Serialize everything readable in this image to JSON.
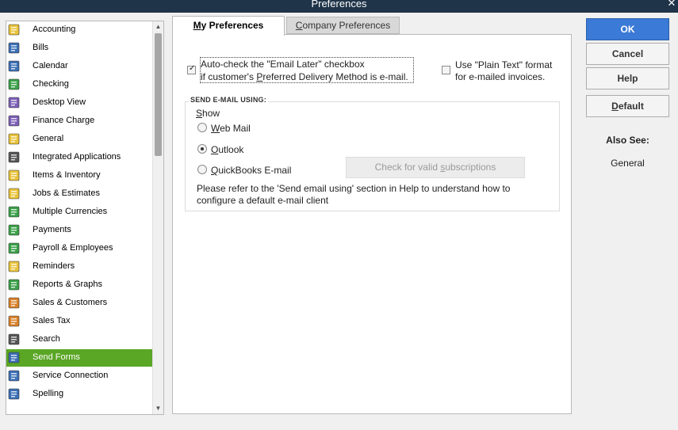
{
  "window": {
    "title": "Preferences"
  },
  "sidebar": {
    "items": [
      {
        "label": "Accounting",
        "icon": "accounting-icon",
        "color": "#e8c23a"
      },
      {
        "label": "Bills",
        "icon": "bills-icon",
        "color": "#3c6fb5"
      },
      {
        "label": "Calendar",
        "icon": "calendar-icon",
        "color": "#3c6fb5"
      },
      {
        "label": "Checking",
        "icon": "checking-icon",
        "color": "#3aa048"
      },
      {
        "label": "Desktop View",
        "icon": "desktop-view-icon",
        "color": "#7c5fb5"
      },
      {
        "label": "Finance Charge",
        "icon": "finance-charge-icon",
        "color": "#7c5fb5"
      },
      {
        "label": "General",
        "icon": "general-icon",
        "color": "#e8c23a"
      },
      {
        "label": "Integrated Applications",
        "icon": "integrated-applications-icon",
        "color": "#555555"
      },
      {
        "label": "Items & Inventory",
        "icon": "items-inventory-icon",
        "color": "#e8c23a"
      },
      {
        "label": "Jobs & Estimates",
        "icon": "jobs-estimates-icon",
        "color": "#e8c23a"
      },
      {
        "label": "Multiple Currencies",
        "icon": "multiple-currencies-icon",
        "color": "#3aa048"
      },
      {
        "label": "Payments",
        "icon": "payments-icon",
        "color": "#3aa048"
      },
      {
        "label": "Payroll & Employees",
        "icon": "payroll-employees-icon",
        "color": "#3aa048"
      },
      {
        "label": "Reminders",
        "icon": "reminders-icon",
        "color": "#e8c23a"
      },
      {
        "label": "Reports & Graphs",
        "icon": "reports-graphs-icon",
        "color": "#3aa048"
      },
      {
        "label": "Sales & Customers",
        "icon": "sales-customers-icon",
        "color": "#d9822b"
      },
      {
        "label": "Sales Tax",
        "icon": "sales-tax-icon",
        "color": "#d9822b"
      },
      {
        "label": "Search",
        "icon": "search-icon",
        "color": "#555555"
      },
      {
        "label": "Send Forms",
        "icon": "send-forms-icon",
        "color": "#3c6fb5",
        "selected": true
      },
      {
        "label": "Service Connection",
        "icon": "service-connection-icon",
        "color": "#3c6fb5"
      },
      {
        "label": "Spelling",
        "icon": "spelling-icon",
        "color": "#3c6fb5"
      }
    ],
    "selected_color": "#5aa625"
  },
  "tabs": {
    "my": {
      "label_ul": "M",
      "label_rest": "y Preferences"
    },
    "company": {
      "label_ul": "C",
      "label_rest": "ompany Preferences"
    }
  },
  "options": {
    "auto_check": {
      "line1": "Auto-check the \"Email Later\" checkbox",
      "line2_pre": "if customer's ",
      "line2_ul": "P",
      "line2_post": "referred Delivery Method is e-mail.",
      "checked": true
    },
    "plain_text": {
      "line1": "Use \"Plain Text\" format",
      "line2": "for e-mailed invoices.",
      "checked": false
    }
  },
  "send_email": {
    "legend": "SEND E-MAIL USING:",
    "show_ul": "S",
    "show_rest": "how",
    "radios": [
      {
        "ul": "W",
        "rest": "eb Mail",
        "selected": false
      },
      {
        "ul": "O",
        "rest": "utlook",
        "selected": true
      },
      {
        "ul": "Q",
        "rest": "uickBooks E-mail",
        "selected": false
      }
    ],
    "check_button": {
      "pre": "Check for valid ",
      "ul": "s",
      "post": "ubscriptions"
    },
    "note_line1": "Please refer to the 'Send email using' section in Help to understand how to",
    "note_line2": "configure a default e-mail client"
  },
  "buttons": {
    "ok": "OK",
    "cancel": "Cancel",
    "help": "Help",
    "default_ul": "D",
    "default_rest": "efault"
  },
  "also_see": {
    "title": "Also See:",
    "link": "General"
  },
  "colors": {
    "accent": "#3b7ad6",
    "titlebar": "#1f3449"
  }
}
